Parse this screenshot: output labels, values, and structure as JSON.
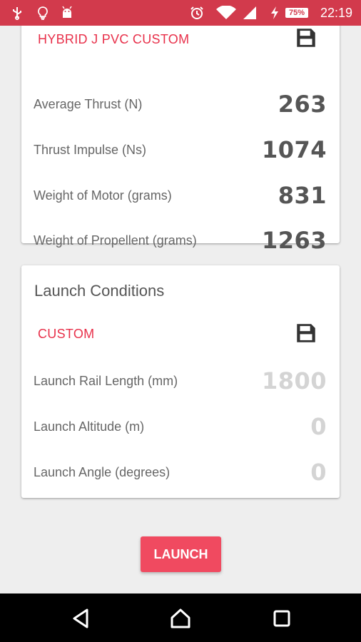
{
  "status_bar": {
    "icons": [
      "usb-icon",
      "bulb-icon",
      "android-icon",
      "alarm-icon",
      "wifi-icon",
      "signal-icon",
      "charging-icon",
      "battery-icon"
    ],
    "battery_percent": "75%",
    "time": "22:19"
  },
  "motor_card": {
    "preset": "HYBRID J PVC CUSTOM",
    "rows": [
      {
        "label": "Average Thrust (N)",
        "value": "263"
      },
      {
        "label": "Thrust Impulse (Ns)",
        "value": "1074"
      },
      {
        "label": "Weight of Motor (grams)",
        "value": "831"
      },
      {
        "label": "Weight of Propellent (grams)",
        "value": "1263"
      }
    ]
  },
  "launch_card": {
    "title": "Launch Conditions",
    "preset": "CUSTOM",
    "rows": [
      {
        "label": "Launch Rail Length (mm)",
        "value": "1800"
      },
      {
        "label": "Launch Altitude (m)",
        "value": "0"
      },
      {
        "label": "Launch Angle (degrees)",
        "value": "0"
      }
    ]
  },
  "launch_button": {
    "label": "LAUNCH"
  },
  "colors": {
    "status_bar": "#d23a4c",
    "accent": "#e8304a",
    "button": "#f04a60",
    "value_text": "#555555",
    "value_dim": "#d4d4d4"
  }
}
